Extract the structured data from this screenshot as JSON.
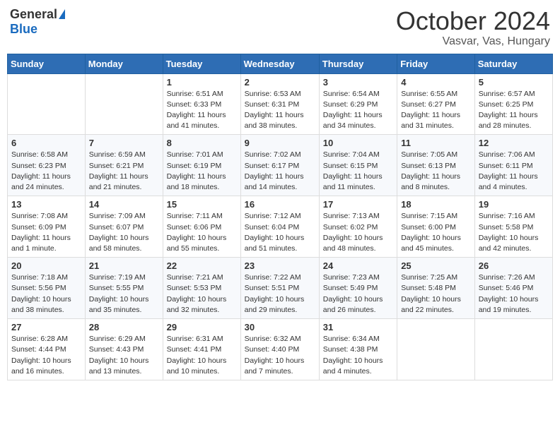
{
  "header": {
    "logo": {
      "general": "General",
      "blue": "Blue"
    },
    "title": "October 2024",
    "subtitle": "Vasvar, Vas, Hungary"
  },
  "calendar": {
    "weekdays": [
      "Sunday",
      "Monday",
      "Tuesday",
      "Wednesday",
      "Thursday",
      "Friday",
      "Saturday"
    ],
    "weeks": [
      [
        {
          "day": "",
          "info": ""
        },
        {
          "day": "",
          "info": ""
        },
        {
          "day": "1",
          "info": "Sunrise: 6:51 AM\nSunset: 6:33 PM\nDaylight: 11 hours and 41 minutes."
        },
        {
          "day": "2",
          "info": "Sunrise: 6:53 AM\nSunset: 6:31 PM\nDaylight: 11 hours and 38 minutes."
        },
        {
          "day": "3",
          "info": "Sunrise: 6:54 AM\nSunset: 6:29 PM\nDaylight: 11 hours and 34 minutes."
        },
        {
          "day": "4",
          "info": "Sunrise: 6:55 AM\nSunset: 6:27 PM\nDaylight: 11 hours and 31 minutes."
        },
        {
          "day": "5",
          "info": "Sunrise: 6:57 AM\nSunset: 6:25 PM\nDaylight: 11 hours and 28 minutes."
        }
      ],
      [
        {
          "day": "6",
          "info": "Sunrise: 6:58 AM\nSunset: 6:23 PM\nDaylight: 11 hours and 24 minutes."
        },
        {
          "day": "7",
          "info": "Sunrise: 6:59 AM\nSunset: 6:21 PM\nDaylight: 11 hours and 21 minutes."
        },
        {
          "day": "8",
          "info": "Sunrise: 7:01 AM\nSunset: 6:19 PM\nDaylight: 11 hours and 18 minutes."
        },
        {
          "day": "9",
          "info": "Sunrise: 7:02 AM\nSunset: 6:17 PM\nDaylight: 11 hours and 14 minutes."
        },
        {
          "day": "10",
          "info": "Sunrise: 7:04 AM\nSunset: 6:15 PM\nDaylight: 11 hours and 11 minutes."
        },
        {
          "day": "11",
          "info": "Sunrise: 7:05 AM\nSunset: 6:13 PM\nDaylight: 11 hours and 8 minutes."
        },
        {
          "day": "12",
          "info": "Sunrise: 7:06 AM\nSunset: 6:11 PM\nDaylight: 11 hours and 4 minutes."
        }
      ],
      [
        {
          "day": "13",
          "info": "Sunrise: 7:08 AM\nSunset: 6:09 PM\nDaylight: 11 hours and 1 minute."
        },
        {
          "day": "14",
          "info": "Sunrise: 7:09 AM\nSunset: 6:07 PM\nDaylight: 10 hours and 58 minutes."
        },
        {
          "day": "15",
          "info": "Sunrise: 7:11 AM\nSunset: 6:06 PM\nDaylight: 10 hours and 55 minutes."
        },
        {
          "day": "16",
          "info": "Sunrise: 7:12 AM\nSunset: 6:04 PM\nDaylight: 10 hours and 51 minutes."
        },
        {
          "day": "17",
          "info": "Sunrise: 7:13 AM\nSunset: 6:02 PM\nDaylight: 10 hours and 48 minutes."
        },
        {
          "day": "18",
          "info": "Sunrise: 7:15 AM\nSunset: 6:00 PM\nDaylight: 10 hours and 45 minutes."
        },
        {
          "day": "19",
          "info": "Sunrise: 7:16 AM\nSunset: 5:58 PM\nDaylight: 10 hours and 42 minutes."
        }
      ],
      [
        {
          "day": "20",
          "info": "Sunrise: 7:18 AM\nSunset: 5:56 PM\nDaylight: 10 hours and 38 minutes."
        },
        {
          "day": "21",
          "info": "Sunrise: 7:19 AM\nSunset: 5:55 PM\nDaylight: 10 hours and 35 minutes."
        },
        {
          "day": "22",
          "info": "Sunrise: 7:21 AM\nSunset: 5:53 PM\nDaylight: 10 hours and 32 minutes."
        },
        {
          "day": "23",
          "info": "Sunrise: 7:22 AM\nSunset: 5:51 PM\nDaylight: 10 hours and 29 minutes."
        },
        {
          "day": "24",
          "info": "Sunrise: 7:23 AM\nSunset: 5:49 PM\nDaylight: 10 hours and 26 minutes."
        },
        {
          "day": "25",
          "info": "Sunrise: 7:25 AM\nSunset: 5:48 PM\nDaylight: 10 hours and 22 minutes."
        },
        {
          "day": "26",
          "info": "Sunrise: 7:26 AM\nSunset: 5:46 PM\nDaylight: 10 hours and 19 minutes."
        }
      ],
      [
        {
          "day": "27",
          "info": "Sunrise: 6:28 AM\nSunset: 4:44 PM\nDaylight: 10 hours and 16 minutes."
        },
        {
          "day": "28",
          "info": "Sunrise: 6:29 AM\nSunset: 4:43 PM\nDaylight: 10 hours and 13 minutes."
        },
        {
          "day": "29",
          "info": "Sunrise: 6:31 AM\nSunset: 4:41 PM\nDaylight: 10 hours and 10 minutes."
        },
        {
          "day": "30",
          "info": "Sunrise: 6:32 AM\nSunset: 4:40 PM\nDaylight: 10 hours and 7 minutes."
        },
        {
          "day": "31",
          "info": "Sunrise: 6:34 AM\nSunset: 4:38 PM\nDaylight: 10 hours and 4 minutes."
        },
        {
          "day": "",
          "info": ""
        },
        {
          "day": "",
          "info": ""
        }
      ]
    ]
  }
}
